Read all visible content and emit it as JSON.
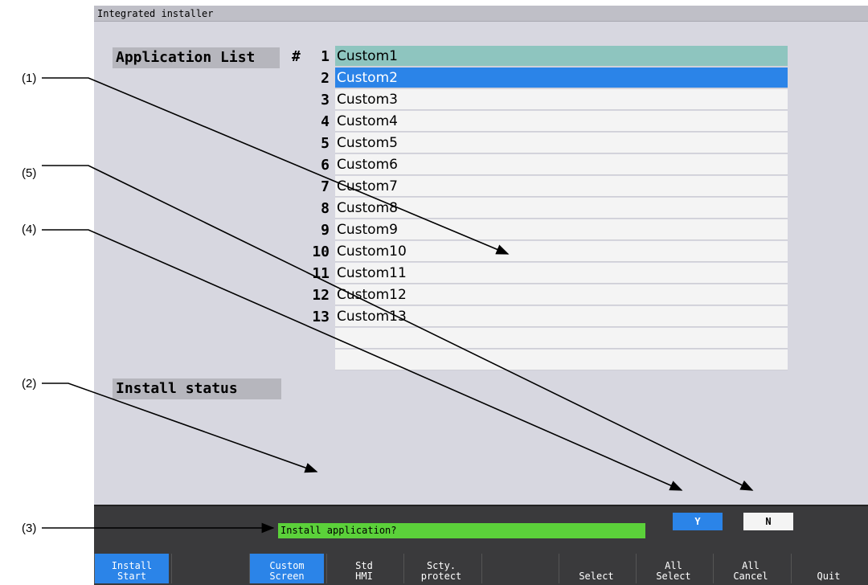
{
  "window": {
    "title": "Integrated installer"
  },
  "app_list": {
    "label": "Application List",
    "hash": "#",
    "rows": [
      {
        "num": "1",
        "name": "Custom1"
      },
      {
        "num": "2",
        "name": "Custom2"
      },
      {
        "num": "3",
        "name": "Custom3"
      },
      {
        "num": "4",
        "name": "Custom4"
      },
      {
        "num": "5",
        "name": "Custom5"
      },
      {
        "num": "6",
        "name": "Custom6"
      },
      {
        "num": "7",
        "name": "Custom7"
      },
      {
        "num": "8",
        "name": "Custom8"
      },
      {
        "num": "9",
        "name": "Custom9"
      },
      {
        "num": "10",
        "name": "Custom10"
      },
      {
        "num": "11",
        "name": "Custom11"
      },
      {
        "num": "12",
        "name": "Custom12"
      },
      {
        "num": "13",
        "name": "Custom13"
      },
      {
        "num": "",
        "name": ""
      },
      {
        "num": "",
        "name": ""
      }
    ]
  },
  "install_status": {
    "label": "Install status"
  },
  "prompt": {
    "message": "Install application?",
    "yes": "Y",
    "no": "N"
  },
  "function_keys": [
    {
      "line1": "Install",
      "line2": "Start",
      "active": true
    },
    {
      "line1": "",
      "line2": "",
      "active": false
    },
    {
      "line1": "Custom",
      "line2": "Screen",
      "active": true
    },
    {
      "line1": "Std",
      "line2": "HMI",
      "active": false
    },
    {
      "line1": "Scty.",
      "line2": "protect",
      "active": false
    },
    {
      "line1": "",
      "line2": "",
      "active": false
    },
    {
      "line1": "",
      "line2": "Select",
      "active": false
    },
    {
      "line1": "All",
      "line2": "Select",
      "active": false
    },
    {
      "line1": "All",
      "line2": "Cancel",
      "active": false
    },
    {
      "line1": "",
      "line2": "Quit",
      "active": false
    }
  ],
  "annotations": [
    "(1)",
    "(5)",
    "(4)",
    "(2)",
    "(3)"
  ],
  "colors": {
    "highlight_blue": "#2b84e8",
    "cursor_teal": "#8ec5bf",
    "message_green": "#5bd13a"
  }
}
